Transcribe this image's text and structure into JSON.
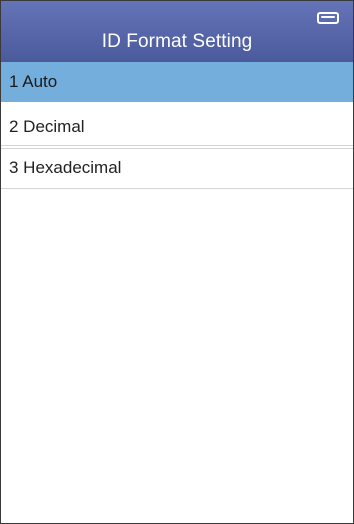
{
  "header": {
    "title": "ID Format Setting",
    "battery_icon": "battery-icon"
  },
  "menu": {
    "items": [
      {
        "label": "1 Auto",
        "selected": true
      },
      {
        "label": "2 Decimal",
        "selected": false
      },
      {
        "label": "3 Hexadecimal",
        "selected": false
      }
    ]
  },
  "colors": {
    "title_bar": "#5666aa",
    "selected_row": "#74aedd",
    "text": "#222222"
  }
}
